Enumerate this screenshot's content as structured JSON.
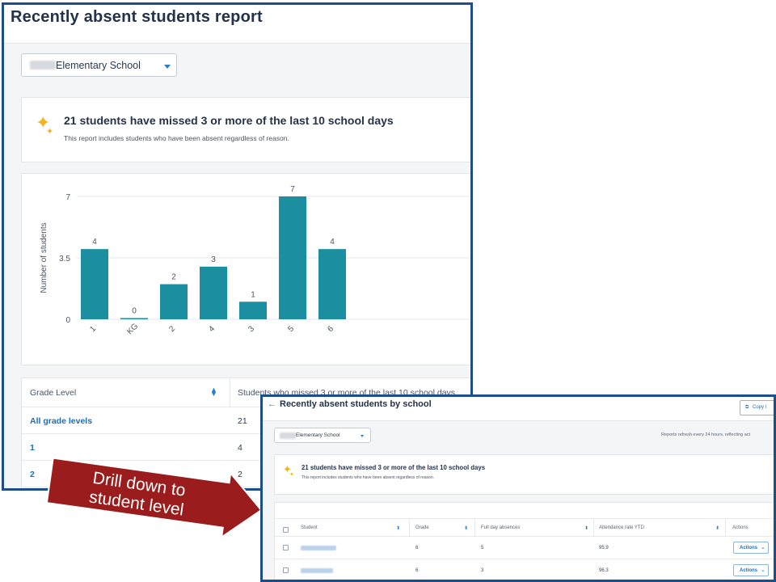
{
  "report": {
    "title": "Recently absent students report",
    "school_select": {
      "value": "Elementary School"
    },
    "summary": {
      "headline": "21 students have missed 3 or more of the last 10 school days",
      "subtext": "This report includes students who have been absent regardless of reason."
    },
    "grade_table": {
      "headers": [
        "Grade Level",
        "Students who missed 3 or more of the last 10 school days"
      ],
      "rows": [
        {
          "grade": "All grade levels",
          "count": "21"
        },
        {
          "grade": "1",
          "count": "4"
        },
        {
          "grade": "2",
          "count": "2"
        }
      ]
    }
  },
  "chart_data": {
    "type": "bar",
    "categories": [
      "1",
      "KG",
      "2",
      "4",
      "3",
      "5",
      "6"
    ],
    "values": [
      4,
      0,
      2,
      3,
      1,
      7,
      4
    ],
    "ylabel": "Number of students",
    "xlabel": "",
    "ylim": [
      0,
      7
    ],
    "yticks": [
      "0",
      "3.5",
      "7"
    ],
    "bar_color": "#1b8ea0",
    "grid": true
  },
  "callout": {
    "text_line1": "Drill down to",
    "text_line2": "student level",
    "color": "#9b1c1c"
  },
  "detail": {
    "back_arrow": "←",
    "title": "Recently absent students by school",
    "copy_label": "Copy l",
    "school_select": {
      "value": "Elementary School"
    },
    "refresh_note": "Reports refresh every 24 hours, reflecting act",
    "summary": {
      "headline": "21 students have missed 3 or more of the last 10 school days",
      "subtext": "This report includes students who have been absent regardless of reason."
    },
    "table": {
      "headers": {
        "student": "Student",
        "grade": "Grade",
        "absences": "Full day absences",
        "attendance": "Attendance rate YTD",
        "actions": "Actions"
      },
      "rows": [
        {
          "grade": "6",
          "absences": "5",
          "attendance": "95.9",
          "action": "Actions"
        },
        {
          "grade": "6",
          "absences": "3",
          "attendance": "96.3",
          "action": "Actions"
        }
      ]
    }
  }
}
